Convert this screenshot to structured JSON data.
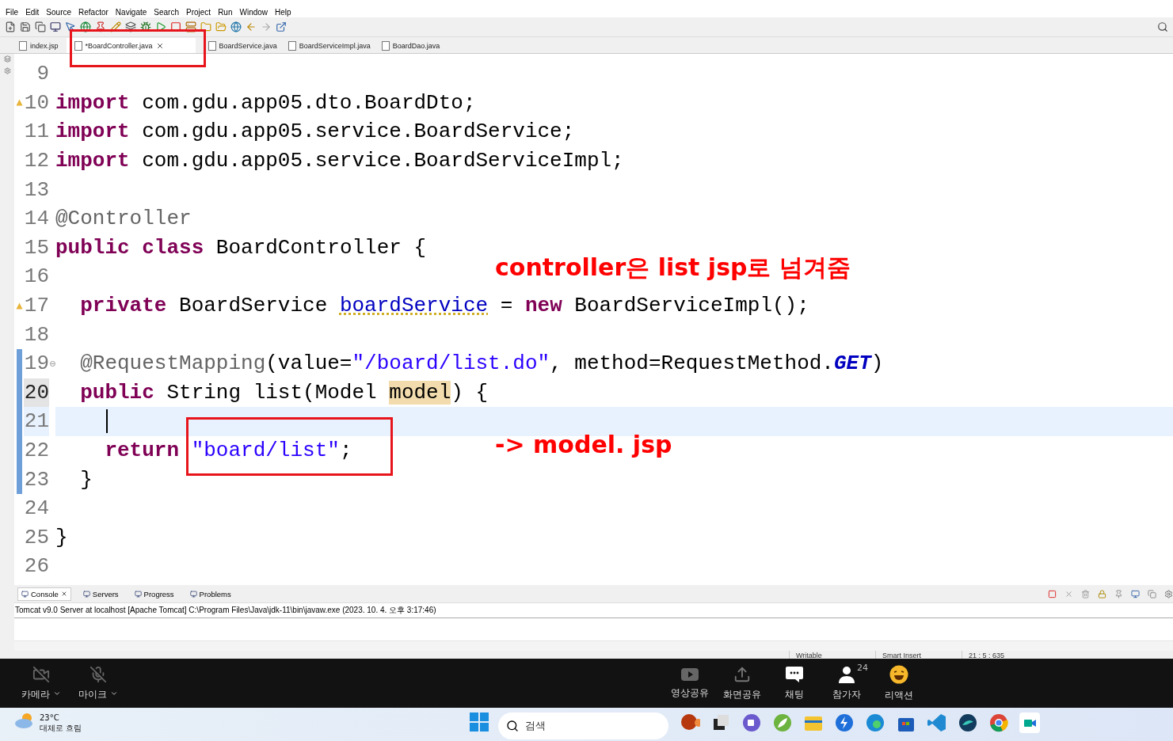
{
  "menu": [
    "File",
    "Edit",
    "Source",
    "Refactor",
    "Navigate",
    "Search",
    "Project",
    "Run",
    "Window",
    "Help"
  ],
  "editor_tabs": [
    {
      "label": "index.jsp",
      "selected": false
    },
    {
      "label": "*BoardController.java",
      "selected": true
    },
    {
      "label": "BoardService.java",
      "selected": false
    },
    {
      "label": "BoardServiceImpl.java",
      "selected": false
    },
    {
      "label": "BoardDao.java",
      "selected": false
    }
  ],
  "code_lines": [
    {
      "number": "9",
      "current": false,
      "selected": false,
      "changed": false,
      "warning": false,
      "foldable": false
    },
    {
      "number": "10",
      "current": false,
      "selected": false,
      "changed": false,
      "warning": true,
      "foldable": false,
      "tokens": [
        {
          "kind": "keyword",
          "text": "import"
        },
        {
          "kind": "plain",
          "text": " com.gdu.app05.dto.BoardDto;"
        }
      ]
    },
    {
      "number": "11",
      "current": false,
      "selected": false,
      "changed": false,
      "warning": false,
      "foldable": false,
      "tokens": [
        {
          "kind": "keyword",
          "text": "import"
        },
        {
          "kind": "plain",
          "text": " com.gdu.app05.service.BoardService;"
        }
      ]
    },
    {
      "number": "12",
      "current": false,
      "selected": false,
      "changed": false,
      "warning": false,
      "foldable": false,
      "tokens": [
        {
          "kind": "keyword",
          "text": "import"
        },
        {
          "kind": "plain",
          "text": " com.gdu.app05.service.BoardServiceImpl;"
        }
      ]
    },
    {
      "number": "13",
      "current": false,
      "selected": false,
      "changed": false,
      "warning": false,
      "foldable": false
    },
    {
      "number": "14",
      "current": false,
      "selected": false,
      "changed": false,
      "warning": false,
      "foldable": false,
      "tokens": [
        {
          "kind": "annotation",
          "text": "@Controller"
        }
      ]
    },
    {
      "number": "15",
      "current": false,
      "selected": false,
      "changed": false,
      "warning": false,
      "foldable": false,
      "tokens": [
        {
          "kind": "keyword",
          "text": "public"
        },
        {
          "kind": "keyword",
          "text": " class"
        },
        {
          "kind": "plain",
          "text": " BoardController {"
        }
      ]
    },
    {
      "number": "16",
      "current": false,
      "selected": false,
      "changed": false,
      "warning": false,
      "foldable": false
    },
    {
      "number": "17",
      "current": false,
      "selected": false,
      "changed": false,
      "warning": true,
      "foldable": false,
      "tokens": [
        {
          "kind": "keyword",
          "text": "  private"
        },
        {
          "kind": "plain",
          "text": " BoardService "
        },
        {
          "kind": "field",
          "text": "boardService"
        },
        {
          "kind": "plain",
          "text": " = "
        },
        {
          "kind": "keyword",
          "text": "new"
        },
        {
          "kind": "plain",
          "text": " BoardServiceImpl();"
        }
      ]
    },
    {
      "number": "18",
      "current": false,
      "selected": false,
      "changed": false,
      "warning": false,
      "foldable": false
    },
    {
      "number": "19",
      "current": false,
      "selected": false,
      "changed": true,
      "warning": false,
      "foldable": true,
      "tokens": [
        {
          "kind": "annotation",
          "text": "  @RequestMapping"
        },
        {
          "kind": "plain",
          "text": "(value="
        },
        {
          "kind": "string",
          "text": "\"/board/list.do\""
        },
        {
          "kind": "plain",
          "text": ", method=RequestMethod."
        },
        {
          "kind": "constant",
          "text": "GET"
        },
        {
          "kind": "plain",
          "text": ")"
        }
      ]
    },
    {
      "number": "20",
      "current": false,
      "selected": true,
      "changed": true,
      "warning": false,
      "foldable": false,
      "tokens": [
        {
          "kind": "keyword",
          "text": "  public"
        },
        {
          "kind": "plain",
          "text": " String list(Model "
        },
        {
          "kind": "occurrence",
          "text": "model"
        },
        {
          "kind": "plain",
          "text": ") {"
        }
      ]
    },
    {
      "number": "21",
      "current": true,
      "selected": false,
      "changed": true,
      "warning": false,
      "foldable": false
    },
    {
      "number": "22",
      "current": false,
      "selected": false,
      "changed": true,
      "warning": false,
      "foldable": false,
      "tokens": [
        {
          "kind": "keyword",
          "text": "    return"
        },
        {
          "kind": "string",
          "text": " \"board/list\""
        },
        {
          "kind": "plain",
          "text": ";"
        }
      ]
    },
    {
      "number": "23",
      "current": false,
      "selected": false,
      "changed": true,
      "warning": false,
      "foldable": false,
      "tokens": [
        {
          "kind": "plain",
          "text": "  }"
        }
      ]
    },
    {
      "number": "24",
      "current": false,
      "selected": false,
      "changed": false,
      "warning": false,
      "foldable": false
    },
    {
      "number": "25",
      "current": false,
      "selected": false,
      "changed": false,
      "warning": false,
      "foldable": false,
      "tokens": [
        {
          "kind": "plain",
          "text": "}"
        }
      ]
    },
    {
      "number": "26",
      "current": false,
      "selected": false,
      "changed": false,
      "warning": false,
      "foldable": false
    }
  ],
  "notes": [
    "controller은 list jsp로 넘겨줌",
    "-> model. jsp"
  ],
  "bottom_panel": {
    "tabs": [
      {
        "label": "Console",
        "selected": true
      },
      {
        "label": "Servers",
        "selected": false
      },
      {
        "label": "Progress",
        "selected": false
      },
      {
        "label": "Problems",
        "selected": false
      }
    ],
    "console_header": "Tomcat v9.0 Server at localhost [Apache Tomcat] C:\\Program Files\\Java\\jdk-11\\bin\\javaw.exe  (2023. 10. 4. 오후 3:17:46)"
  },
  "status_bar": [
    "Writable",
    "Smart Insert",
    "21 : 5 : 635"
  ],
  "meeting_bar": {
    "left": [
      {
        "kind": "camera",
        "label": "카메라"
      },
      {
        "kind": "mic",
        "label": "마이크"
      }
    ],
    "right": [
      {
        "kind": "video",
        "label": "영상공유"
      },
      {
        "kind": "screen",
        "label": "화면공유"
      },
      {
        "kind": "chat",
        "label": "채팅"
      },
      {
        "kind": "people",
        "label": "참가자",
        "count": "24"
      },
      {
        "kind": "reaction",
        "label": "리액션"
      }
    ]
  },
  "taskbar": {
    "temperature": "23°C",
    "weather": "대체로 흐림",
    "search_placeholder": "검색"
  }
}
